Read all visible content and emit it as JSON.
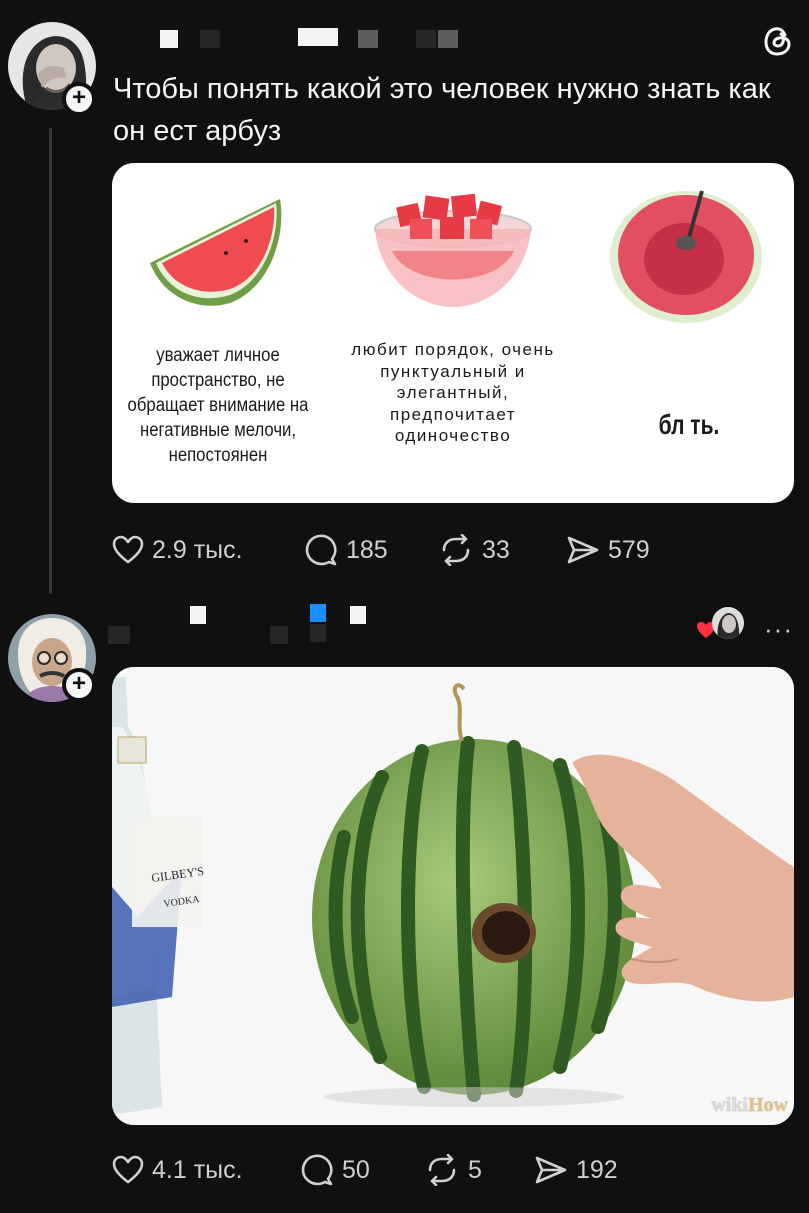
{
  "post1": {
    "text": "Чтобы понять какой это человек нужно знать как он ест арбуз",
    "image": {
      "caption1": "уважает личное пространство, не обращает внимание на негативные мелочи, непостоянен",
      "caption2": "любит порядок, очень пунктуальный и элегантный, предпочитает одиночество",
      "caption3": "бл ть."
    },
    "actions": {
      "likes": "2.9 тыс.",
      "replies": "185",
      "reposts": "33",
      "shares": "579"
    }
  },
  "post2": {
    "watermark_a": "wiki",
    "watermark_b": "How",
    "more_label": "···",
    "actions": {
      "likes": "4.1 тыс.",
      "replies": "50",
      "reposts": "5",
      "shares": "192"
    }
  },
  "icons": [
    "plus-icon",
    "threads-logo-icon",
    "heart-icon",
    "comment-icon",
    "repost-icon",
    "share-icon",
    "more-icon"
  ],
  "colors": {
    "background": "#101010",
    "text": "#f3f5f7",
    "muted": "#d0d0d0",
    "heart_red": "#ff3040",
    "verified_blue": "#1d8fff"
  }
}
